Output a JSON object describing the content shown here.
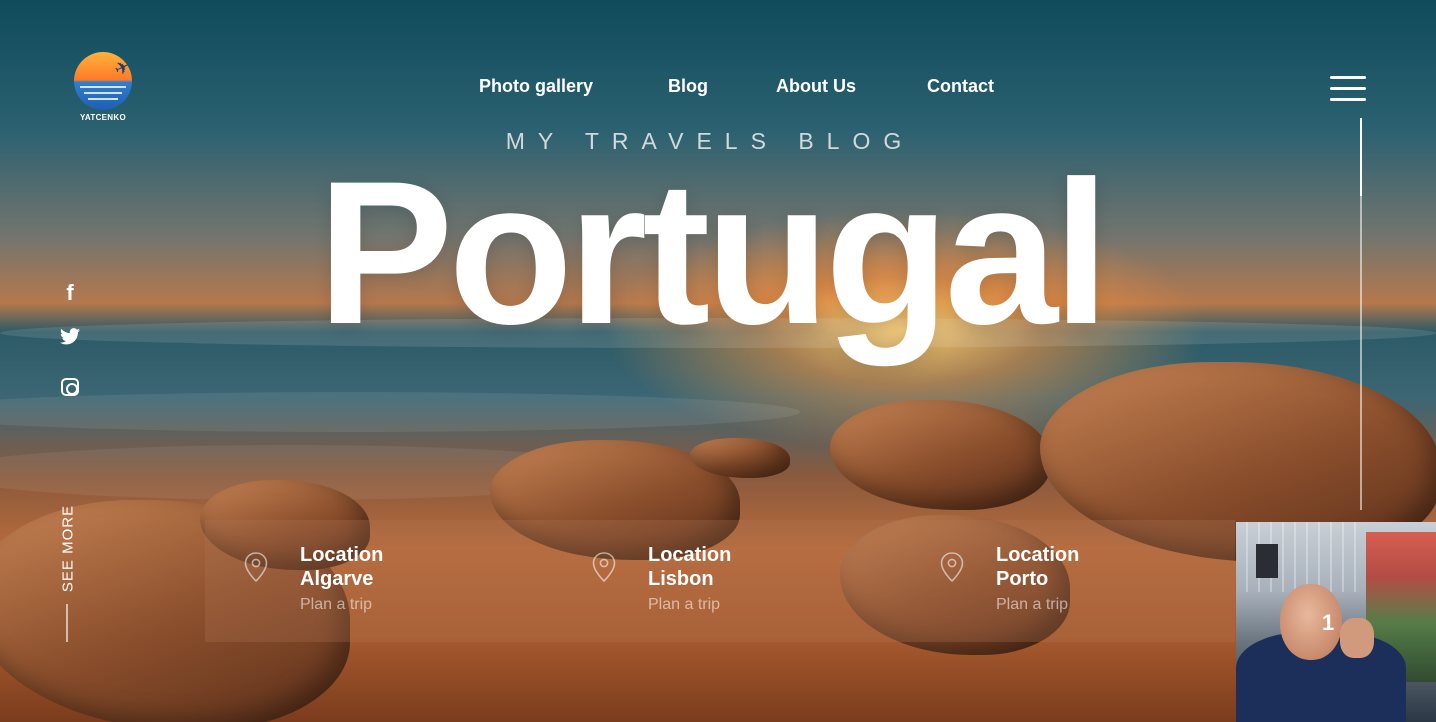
{
  "logo": {
    "name": "YATCENKO",
    "icon": "sunset-plane-logo"
  },
  "nav": {
    "items": [
      {
        "label": "Photo gallery"
      },
      {
        "label": "Blog"
      },
      {
        "label": "About Us"
      },
      {
        "label": "Contact"
      }
    ]
  },
  "menu": {
    "icon": "hamburger-menu-icon"
  },
  "hero": {
    "subtitle": "MY TRAVELS BLOG",
    "title": "Portugal"
  },
  "social": {
    "facebook": "f",
    "twitter_icon": "twitter-icon",
    "instagram_icon": "instagram-icon"
  },
  "see_more": "SEE MORE",
  "locations": [
    {
      "label": "Location",
      "city": "Algarve",
      "cta": "Plan a trip",
      "icon": "map-pin-icon"
    },
    {
      "label": "Location",
      "city": "Lisbon",
      "cta": "Plan a trip",
      "icon": "map-pin-icon"
    },
    {
      "label": "Location",
      "city": "Porto",
      "cta": "Plan a trip",
      "icon": "map-pin-icon"
    }
  ],
  "thumbnail": {
    "number": "1"
  },
  "colors": {
    "text": "#ffffff",
    "sky_top": "#0f4b5b",
    "sand": "#b86a3a",
    "sun": "#ffcd6e"
  }
}
